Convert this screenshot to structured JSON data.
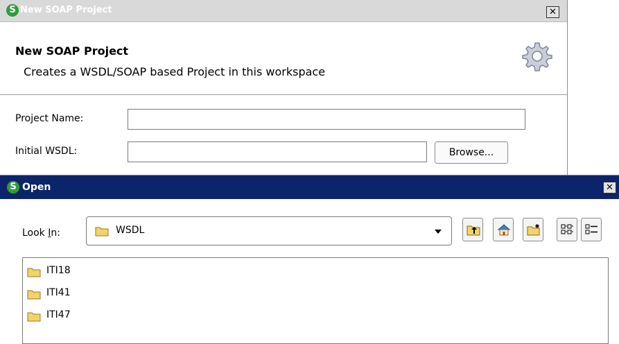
{
  "soap_dialog": {
    "title": "New SOAP Project",
    "header_title": "New SOAP Project",
    "header_description": "Creates a WSDL/SOAP based Project in this workspace",
    "project_name_label": "Project Name:",
    "project_name_value": "",
    "initial_wsdl_label": "Initial WSDL:",
    "initial_wsdl_value": "",
    "browse_label": "Browse..."
  },
  "open_dialog": {
    "title": "Open",
    "look_in_label_prefix": "Look ",
    "look_in_label_mnemonic": "I",
    "look_in_label_suffix": "n:",
    "look_in_value": "WSDL",
    "files": [
      "ITI18",
      "ITI41",
      "ITI47"
    ]
  },
  "icons": {
    "app_logo": "soapui-logo-icon",
    "gear": "gear-icon",
    "close": "close-icon",
    "folder": "folder-icon",
    "up_folder": "up-one-level-icon",
    "home": "home-icon",
    "new_folder": "new-folder-icon",
    "list_view": "list-view-icon",
    "details_view": "details-view-icon"
  },
  "colors": {
    "open_titlebar": "#0c246a",
    "logo_green": "#2e9e3c",
    "folder_yellow": "#f2d36b"
  }
}
